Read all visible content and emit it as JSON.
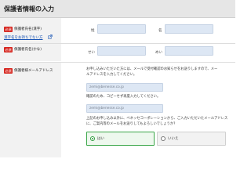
{
  "page": {
    "title": "保護者情報の入力"
  },
  "form": {
    "name_kanji": {
      "badge": "必須",
      "label": "保護者氏名(漢字)",
      "link": "漢字名をお持ちでない方",
      "sei_prefix": "姓",
      "mei_prefix": "名"
    },
    "name_kana": {
      "badge": "必須",
      "label": "保護者氏名(かな)",
      "sei_prefix": "せい",
      "mei_prefix": "めい"
    },
    "email": {
      "badge": "必須",
      "label": "保護者様メールアドレス",
      "description_line1": "お申し込みいただいた方には、メールで受付確認のお知らせをお送りしますので、メー",
      "description_line2": "ルアドレスを入力してください。",
      "email_placeholder": "zemi@benesse.co.jp",
      "confirm_note": "確認のため、コピーせず再度入力してください。",
      "confirm_placeholder": "zemi@benesse.co.jp",
      "consent_line1": "上記のお申し込み以外に、ベネッセコーポレーションから、ご入力いただいたメールアドレス",
      "consent_line2": "に、ご案内等のメールをお送りしてもよろしいでしょうか?",
      "option_yes": "はい",
      "option_no": "いいえ",
      "selected": "はい"
    }
  },
  "colors": {
    "required_badge": "#d6261f",
    "input_bg": "#dde7f4",
    "selected_border": "#3aa648",
    "link": "#1a55b5"
  }
}
